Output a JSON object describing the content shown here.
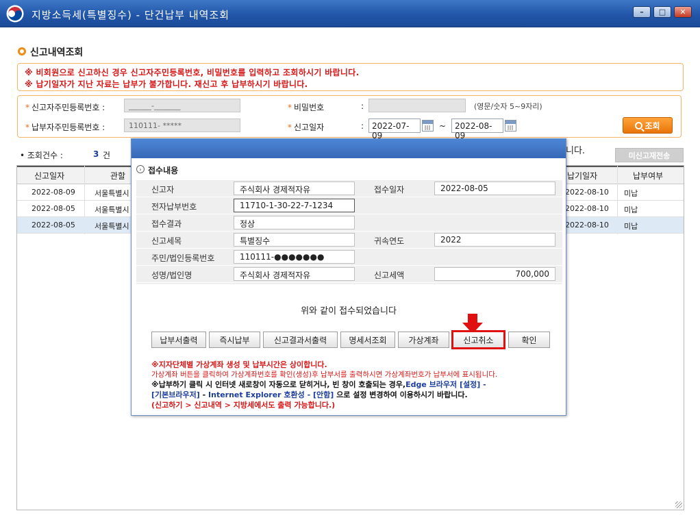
{
  "window": {
    "title": "지방소득세(특별징수) - 단건납부 내역조회",
    "minimize": "–",
    "maximize": "□",
    "close": "✕"
  },
  "section": {
    "title": "신고내역조회"
  },
  "notice": {
    "line1": "※ 비회원으로 신고하신 경우 신고자주민등록번호, 비밀번호를 입력하고 조회하시기 바랍니다.",
    "line2": "※ 납기일자가 지난 자료는 납부가 불가합니다. 재신고 후 납부하시기 바랍니다."
  },
  "search": {
    "reporter_id_label": "신고자주민등록번호 :",
    "reporter_id_value": "______-_______",
    "payer_id_label": "납부자주민등록번호 :",
    "payer_id_value": "110111-  *****",
    "password_label": "비밀번호",
    "password_colon": ":",
    "password_hint": "(영문/숫자 5~9자리)",
    "date_label": "신고일자",
    "date_colon": ":",
    "date_from": "2022-07-09",
    "date_sep": "~",
    "date_to": "2022-08-09",
    "search_button": "조회"
  },
  "results": {
    "count_label": "• 조회건수 :",
    "count_value": "3",
    "count_unit": "건",
    "trail_text": "니다.",
    "resend_button": "미신고재전송",
    "columns": [
      "신고일자",
      "관할",
      "납기일자",
      "납부여부"
    ],
    "rows": [
      {
        "date": "2022-08-09",
        "office": "서울특별시",
        "due": "2022-08-10",
        "paid": "미납"
      },
      {
        "date": "2022-08-05",
        "office": "서울특별시",
        "due": "2022-08-10",
        "paid": "미납"
      },
      {
        "date": "2022-08-05",
        "office": "서울특별시",
        "due": "2022-08-10",
        "paid": "미납"
      }
    ]
  },
  "dialog": {
    "section_title": "접수내용",
    "fields": {
      "reporter_label": "신고자",
      "reporter_value": "주식회사 경제적자유",
      "received_date_label": "접수일자",
      "received_date_value": "2022-08-05",
      "epay_label": "전자납부번호",
      "epay_value": "11710-1-30-22-7-1234",
      "result_label": "접수결과",
      "result_value": "정상",
      "tax_item_label": "신고세목",
      "tax_item_value": "특별징수",
      "year_label": "귀속연도",
      "year_value": "2022",
      "regno_label": "주민/법인등록번호",
      "regno_value": "110111-●●●●●●●",
      "name_label": "성명/법인명",
      "name_value": "주식회사 경제적자유",
      "amount_label": "신고세액",
      "amount_value": "700,000"
    },
    "done_message": "위와 같이 접수되었습니다",
    "buttons": [
      "납부서출력",
      "즉시납부",
      "신고결과서출력",
      "명세서조회",
      "가상계좌",
      "신고취소",
      "확인"
    ],
    "notes": {
      "n1": "※지자단체별 가상계좌 생성 및 납부시간은 상이합니다.",
      "n2": "가상계좌 버튼을 클릭하여 가상계좌번호를 확인(생성)후 납부서를 출력하시면 가상계좌번호가 납부서에 표시됩니다.",
      "n3a": "※납부하기 클릭 시 인터넷 새로창이 자동으로 닫히거나, 빈 창이 호출되는 경우,",
      "n3b": "Edge 브라우저 [설정] -",
      "n4a": "[기본브라우저]",
      "n4b": " - ",
      "n4c": "Internet Explorer 호환성 - [안함]",
      "n4d": " 으로 설정 변경하여 이용하시기 바랍니다.",
      "n5": "(신고하기 > 신고내역 > 지방세에서도 출력 가능합니다.)"
    }
  },
  "colors": {
    "accent": "#f08c12",
    "title_bar": "#2256a8",
    "alert": "#d61818",
    "highlight": "#e01010"
  }
}
